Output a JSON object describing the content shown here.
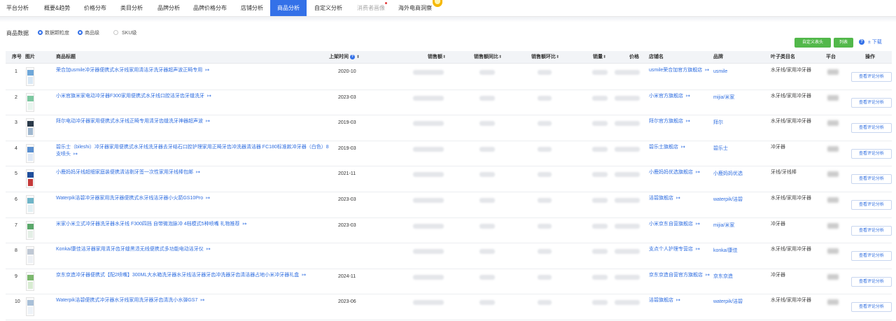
{
  "nav": {
    "items": [
      {
        "label": "平台分析"
      },
      {
        "label": "概要&趋势"
      },
      {
        "label": "价格分布"
      },
      {
        "label": "类目分析"
      },
      {
        "label": "品牌分析"
      },
      {
        "label": "品牌价格分布"
      },
      {
        "label": "店铺分析"
      },
      {
        "label": "商品分析"
      },
      {
        "label": "自定义分析"
      },
      {
        "label": "消费者画像"
      },
      {
        "label": "海外电商洞察"
      }
    ],
    "active": "商品分析",
    "accent_color": "#3471e8"
  },
  "filter": {
    "label": "商品数据",
    "options": [
      "数据颗粒度",
      "商品级",
      "SKU级"
    ]
  },
  "actions": {
    "custom_header": "自定义表头",
    "export": "列表",
    "download": "± 下载"
  },
  "table": {
    "headers": {
      "index": "序号",
      "image": "图片",
      "title": "商品标题",
      "launch": "上架时间",
      "sales_amount": "销售额",
      "amount_yoy": "销售额同比",
      "amount_mom": "销售额环比",
      "sales_volume": "销量",
      "price": "价格",
      "shop": "店铺名",
      "brand": "品牌",
      "leaf_category": "叶子类目名",
      "platform": "平台",
      "operation": "操作"
    },
    "op_label": "查看评论分析",
    "rows": [
      {
        "index": "1",
        "title": "荣合加usmile冲牙器便携式水牙线家用清洁牙洗牙器超声波正畸专用",
        "date": "2020-10",
        "shop": "usmile荣合加官方旗舰店",
        "brand": "usmile",
        "leaf": "水牙线/家用冲牙器"
      },
      {
        "index": "2",
        "title": "小米官旗米家电动冲牙器F300家用便携式水牙线口腔洁牙齿牙缝洗牙",
        "date": "2023-03",
        "shop": "小米官方旗舰店",
        "brand": "mijia/米家",
        "leaf": "水牙线/家用冲牙器"
      },
      {
        "index": "3",
        "title": "拜尔电动冲牙器家用便携式水牙线正畸专用清牙齿缝洗牙神器超声波",
        "date": "2019-03",
        "shop": "拜尔官方旗舰店",
        "brand": "拜尔",
        "leaf": "水牙线/家用冲牙器"
      },
      {
        "index": "4",
        "title": "碧乐士（bileshi）冲牙器家用便携式水牙线洗牙器去牙结石口腔护理家用正畸牙齿冲洗器清洁器 FC180标准款冲牙器（白色）8支喷头",
        "date": "2019-03",
        "shop": "碧乐士旗舰店",
        "brand": "碧乐士",
        "leaf": "冲牙器"
      },
      {
        "index": "5",
        "title": "小鹿妈妈牙线超细家庭装便携清洁剔牙签一次性家用牙线棒包邮",
        "date": "2021-11",
        "shop": "小鹿妈妈优选旗舰店",
        "brand": "小鹿妈妈优选",
        "leaf": "牙线/牙线棒"
      },
      {
        "index": "6",
        "title": "Waterpik洁碧冲牙器家用洗牙器便携式水牙线洁牙器小火箭GS10Pro",
        "date": "2023-03",
        "shop": "洁碧旗舰店",
        "brand": "waterpik/洁碧",
        "leaf": "水牙线/家用冲牙器"
      },
      {
        "index": "7",
        "title": "米家小米立式冲牙器洗牙器水牙线 F300四挡 自带微泡脉冲 4档模式5种喷嘴 礼物推荐",
        "date": "2023-03",
        "shop": "小米京东自营旗舰店",
        "brand": "mijia/米家",
        "leaf": "冲牙器"
      },
      {
        "index": "8",
        "title": "Konka/康佳洁牙器家用清牙齿牙缝黑渍无线便携式多功能电动洁牙仪",
        "date": "",
        "shop": "支点个人护理专营店",
        "brand": "konka/康佳",
        "leaf": "水牙线/家用冲牙器"
      },
      {
        "index": "9",
        "title": "京东京造冲牙器便携式【配2喷嘴】300ML大水箱洗牙器水牙线洁牙器牙齿冲洗器牙齿清洁器占地小米冲牙器礼盒",
        "date": "2024-11",
        "shop": "京东京造自营官方旗舰店",
        "brand": "京东京造",
        "leaf": "冲牙器"
      },
      {
        "index": "10",
        "title": "Waterpik洁碧便携式冲牙器水牙线家用洗牙器牙齿清洗小水弹GS7",
        "date": "2023-06",
        "shop": "洁碧旗舰店",
        "brand": "waterpik/洁碧",
        "leaf": "水牙线/家用冲牙器"
      }
    ]
  }
}
